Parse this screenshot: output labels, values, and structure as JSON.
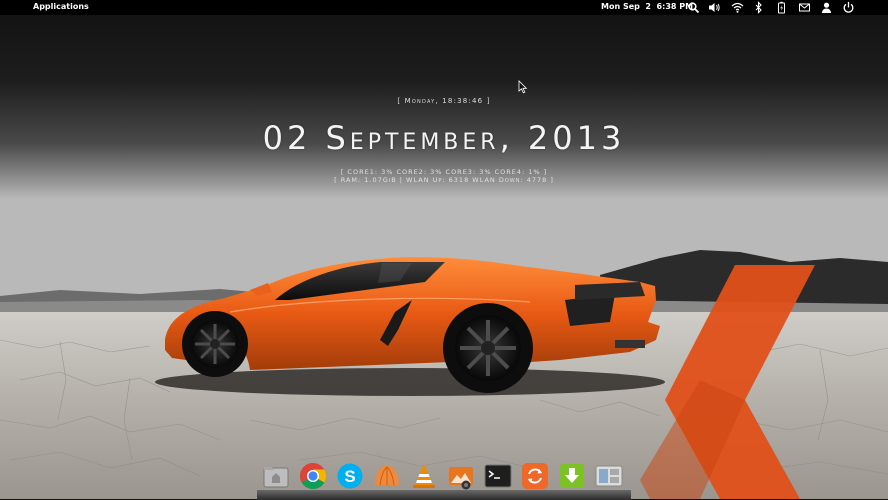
{
  "top_panel": {
    "applications_label": "Applications",
    "clock_text": "Mon Sep  2  6:38 PM",
    "indicators": [
      "search-icon",
      "volume-icon",
      "wifi-icon",
      "bluetooth-icon",
      "battery-icon",
      "mail-icon",
      "user-icon",
      "power-icon"
    ]
  },
  "conky": {
    "time_line": "[ Monday, 18:38:46 ]",
    "date_line": "02 September, 2013",
    "cpu_line": "[ CORE1: 3% CORE2: 3% CORE3: 3% CORE4: 1% ]",
    "net_line": "[ RAM: 1.07GiB | WLAN Up: 6318 WLAN Down: 4778 ]"
  },
  "dock": {
    "items": [
      "files-icon",
      "chrome-icon",
      "skype-icon",
      "shell-icon",
      "vlc-icon",
      "shotwell-icon",
      "terminal-icon",
      "update-icon",
      "download-icon",
      "workspace-switcher-icon"
    ]
  },
  "colors": {
    "panel": "#000000",
    "accent_orange": "#e8561a"
  }
}
